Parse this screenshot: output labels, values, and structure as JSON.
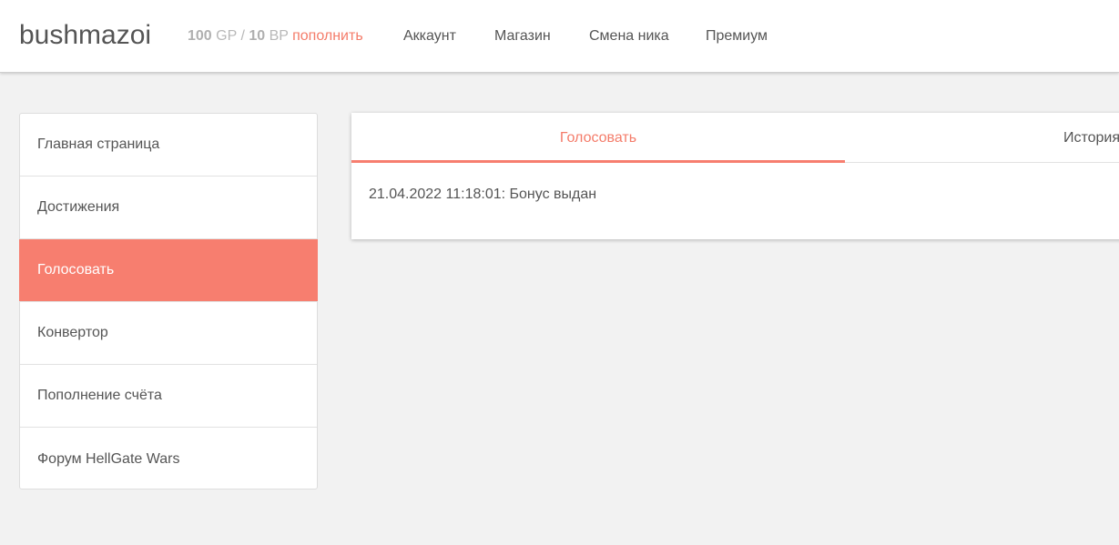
{
  "header": {
    "brand": "bushmazoi",
    "balance": {
      "gp_value": "100",
      "gp_unit": "GP",
      "separator": "/",
      "bp_value": "10",
      "bp_unit": "BP",
      "topup_label": "пополнить"
    },
    "nav": [
      {
        "label": "Аккаунт"
      },
      {
        "label": "Магазин"
      },
      {
        "label": "Смена ника"
      },
      {
        "label": "Премиум"
      }
    ]
  },
  "sidebar": {
    "items": [
      {
        "label": "Главная страница"
      },
      {
        "label": "Достижения"
      },
      {
        "label": "Голосовать",
        "active": true
      },
      {
        "label": "Конвертор"
      },
      {
        "label": "Пополнение счёта"
      },
      {
        "label": "Форум HellGate Wars"
      }
    ]
  },
  "panel": {
    "tabs": [
      {
        "label": "Голосовать",
        "active": true
      },
      {
        "label": "История"
      }
    ],
    "entries": [
      {
        "text": "21.04.2022 11:18:01: Бонус выдан"
      }
    ]
  },
  "colors": {
    "accent": "#f77e6f",
    "background": "#f2f2f2",
    "text": "#555555"
  }
}
